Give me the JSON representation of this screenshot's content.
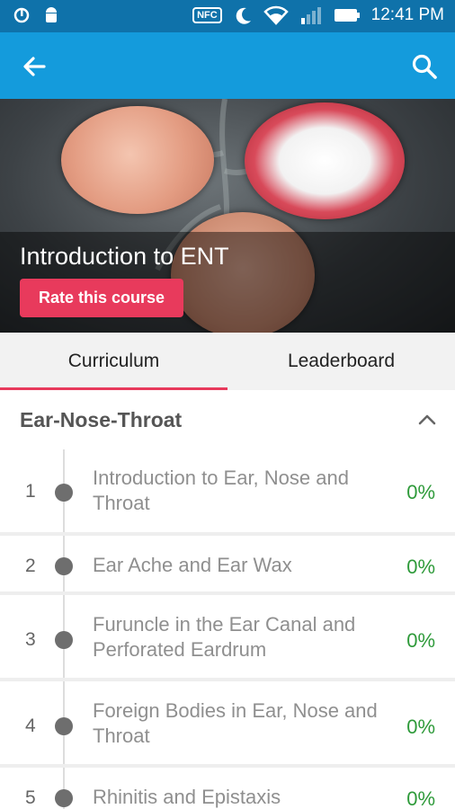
{
  "status_bar": {
    "time": "12:41 PM",
    "nfc_label": "NFC",
    "icons": [
      "notification-icon",
      "android-icon",
      "nfc-icon",
      "moon-icon",
      "wifi-icon",
      "signal-icon",
      "battery-icon"
    ]
  },
  "app_bar": {
    "icons": [
      "back-arrow-icon",
      "search-icon"
    ],
    "color": "#149bdc"
  },
  "hero": {
    "title": "Introduction to ENT",
    "rate_button": "Rate this course"
  },
  "tabs": [
    {
      "label": "Curriculum",
      "active": true
    },
    {
      "label": "Leaderboard",
      "active": false
    }
  ],
  "section": {
    "title": "Ear-Nose-Throat",
    "expanded": true
  },
  "lessons": [
    {
      "number": "1",
      "title": "Introduction to Ear, Nose and Throat",
      "progress": "0%"
    },
    {
      "number": "2",
      "title": "Ear Ache and Ear Wax",
      "progress": "0%"
    },
    {
      "number": "3",
      "title": "Furuncle in the Ear Canal and Perforated Eardrum",
      "progress": "0%"
    },
    {
      "number": "4",
      "title": "Foreign Bodies in Ear, Nose and Throat",
      "progress": "0%"
    },
    {
      "number": "5",
      "title": "Rhinitis and Epistaxis",
      "progress": "0%"
    }
  ],
  "colors": {
    "accent": "#e83a5c",
    "progress": "#2e9a3a",
    "status_bar": "#0f72aa"
  }
}
